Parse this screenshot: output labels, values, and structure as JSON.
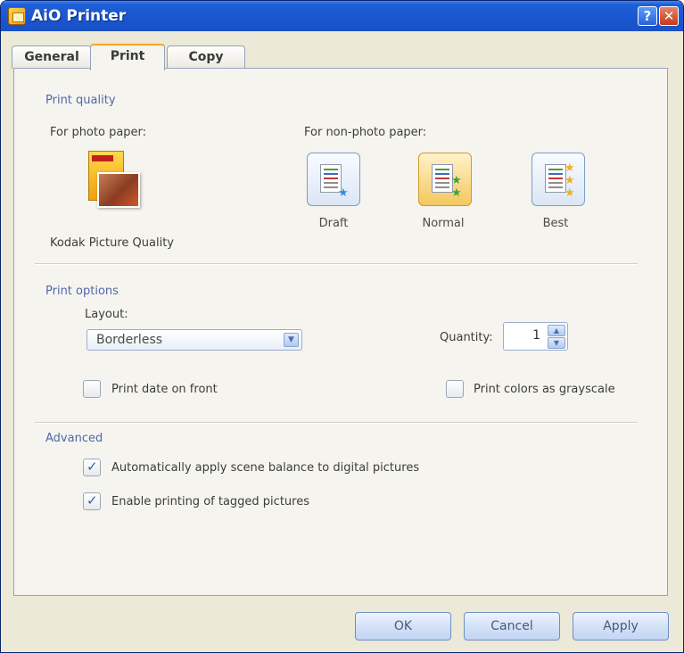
{
  "window": {
    "title": "AiO Printer",
    "help_glyph": "?",
    "close_glyph": "✕"
  },
  "tabs": [
    {
      "label": "General",
      "active": false
    },
    {
      "label": "Print",
      "active": true
    },
    {
      "label": "Copy",
      "active": false
    }
  ],
  "print_quality": {
    "section_title": "Print quality",
    "photo_label": "For photo paper:",
    "nonphoto_label": "For non-photo paper:",
    "kodak_label": "Kodak Picture Quality",
    "options": [
      {
        "label": "Draft",
        "selected": false,
        "icon": "draft-quality-icon"
      },
      {
        "label": "Normal",
        "selected": true,
        "icon": "normal-quality-icon"
      },
      {
        "label": "Best",
        "selected": false,
        "icon": "best-quality-icon"
      }
    ]
  },
  "print_options": {
    "section_title": "Print options",
    "layout_label": "Layout:",
    "layout_value": "Borderless",
    "quantity_label": "Quantity:",
    "quantity_value": "1",
    "print_date_label": "Print date on front",
    "print_date_checked": false,
    "grayscale_label": "Print colors as grayscale",
    "grayscale_checked": false
  },
  "advanced": {
    "section_title": "Advanced",
    "scene_balance_label": "Automatically apply scene balance to digital pictures",
    "scene_balance_checked": true,
    "tagged_label": "Enable printing of tagged pictures",
    "tagged_checked": true
  },
  "buttons": {
    "ok": "OK",
    "cancel": "Cancel",
    "apply": "Apply"
  },
  "colors": {
    "titlebar": "#1f5fd6",
    "section_title": "#5068a8",
    "selected_quality": "#f4c760"
  }
}
